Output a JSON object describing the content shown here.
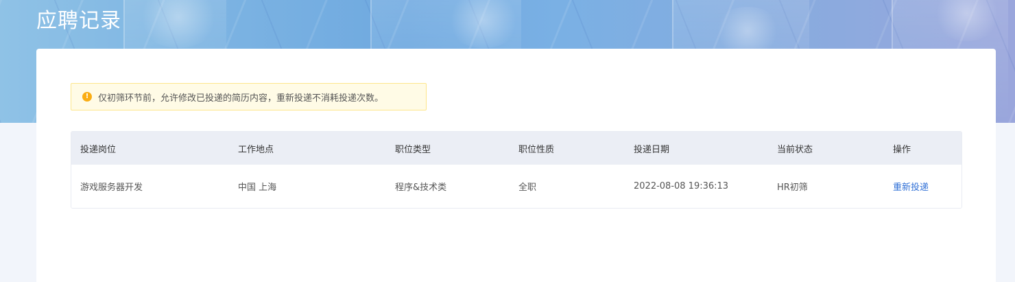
{
  "page": {
    "title": "应聘记录"
  },
  "notice": {
    "icon": "warning-icon",
    "text": "仅初筛环节前，允许修改已投递的简历内容，重新投递不消耗投递次数。"
  },
  "table": {
    "headers": [
      "投递岗位",
      "工作地点",
      "职位类型",
      "职位性质",
      "投递日期",
      "当前状态",
      "操作"
    ],
    "rows": [
      {
        "position": "游戏服务器开发",
        "location": "中国 上海",
        "type": "程序&技术类",
        "nature": "全职",
        "date": "2022-08-08 19:36:13",
        "status": "HR初筛",
        "action": "重新投递"
      }
    ]
  },
  "colors": {
    "accent_link": "#2f6fd6",
    "warning": "#faad14",
    "notice_bg": "#fffbe6"
  }
}
